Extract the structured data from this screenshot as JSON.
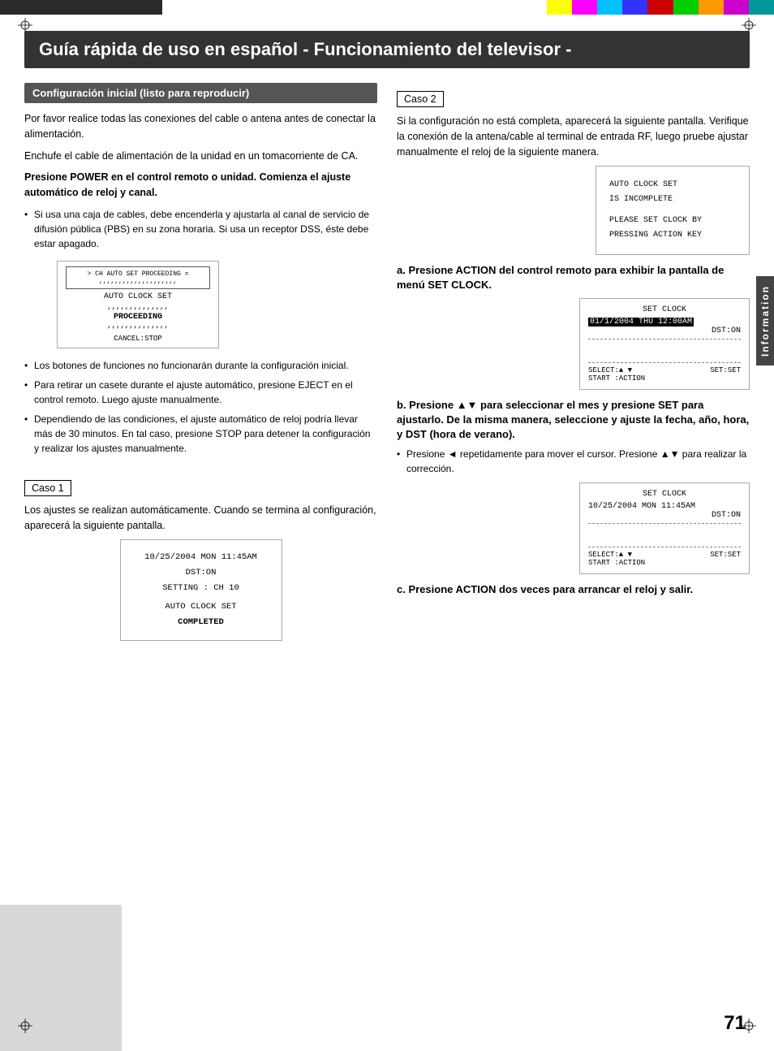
{
  "topbar": {
    "colors": [
      "#333333",
      "#555555",
      "#777777",
      "#999999",
      "#bbbbbb",
      "#ffff00",
      "#ff00ff",
      "#00ffff",
      "#0000ff",
      "#ff0000",
      "#00ff00"
    ]
  },
  "title": "Guía rápida de uso en español - Funcionamiento del televisor -",
  "left": {
    "section_heading": "Configuración inicial (listo para reproducir)",
    "intro_p1": "Por favor realice todas las conexiones del cable o antena antes de conectar la alimentación.",
    "intro_p2": "Enchufe el cable de alimentación de la unidad en un tomacorriente de CA.",
    "intro_bold": "Presione POWER en el control remoto  o unidad. Comienza el ajuste automático de reloj y canal.",
    "bullet1": "Si usa una caja de cables, debe encenderla y ajustarla al canal de servicio de difusión pública (PBS) en su zona horaria. Si usa un receptor DSS, éste debe estar apagado.",
    "screen_proceeding_line1": "> CH AUTO SET PROCEEDING =",
    "screen_proceeding_line2": "AUTO CLOCK SET",
    "screen_proceeding_line3": "PROCEEDING",
    "screen_proceeding_cancel": "CANCEL:STOP",
    "bullet2": "Los botones de funciones no funcionarán durante la configuración inicial.",
    "bullet3": "Para retirar un casete durante el ajuste automático, presione EJECT en el control remoto. Luego ajuste manualmente.",
    "bullet4": "Dependiendo de las condiciones, el ajuste automático de reloj podría llevar más de 30 minutos. En tal caso, presione STOP para detener la configuración y realizar los ajustes manualmente.",
    "caso1_label": "Caso 1",
    "caso1_text": "Los ajustes se realizan automáticamente. Cuando se termina al configuración, aparecerá la siguiente pantalla.",
    "screen_completed_line1": "10/25/2004 MON 11:45AM",
    "screen_completed_line2": "DST:ON",
    "screen_completed_line3": "SETTING : CH 10",
    "screen_completed_line4": "AUTO CLOCK SET",
    "screen_completed_line5": "COMPLETED"
  },
  "right": {
    "caso2_label": "Caso 2",
    "caso2_text": "Si la configuración no está completa, aparecerá la siguiente pantalla. Verifique la conexión de la antena/cable al terminal de entrada RF, luego pruebe ajustar manualmente el reloj de la siguiente manera.",
    "screen_incomplete_line1": "AUTO CLOCK SET",
    "screen_incomplete_line2": "IS INCOMPLETE",
    "screen_incomplete_line3": "PLEASE SET CLOCK BY",
    "screen_incomplete_line4": "PRESSING ACTION KEY",
    "step_a_heading": "a. Presione ACTION del control remoto para exhibir la pantalla de menú SET CLOCK.",
    "screen_setclock1_header": "SET CLOCK",
    "screen_setclock1_date": "01/1/2004 THU 12:00AM",
    "screen_setclock1_dst": "DST:ON",
    "screen_setclock1_select": "SELECT:▲ ▼",
    "screen_setclock1_set": "SET:SET",
    "screen_setclock1_start": "START :ACTION",
    "step_b_heading": "b. Presione ▲▼ para seleccionar el mes y presione SET para ajustarlo. De la misma manera, seleccione y ajuste la fecha, año, hora, y DST (hora de verano).",
    "step_b_bullet": "Presione ◄ repetidamente para mover el cursor. Presione ▲▼ para realizar la corrección.",
    "screen_setclock2_header": "SET CLOCK",
    "screen_setclock2_date": "10/25/2004 MON 11:45AM",
    "screen_setclock2_dst": "DST:ON",
    "screen_setclock2_select": "SELECT:▲ ▼",
    "screen_setclock2_set": "SET:SET",
    "screen_setclock2_start": "START :ACTION",
    "step_c_heading": "c. Presione ACTION dos veces para arrancar el reloj y salir."
  },
  "sidebar_label": "Information",
  "page_number": "71"
}
